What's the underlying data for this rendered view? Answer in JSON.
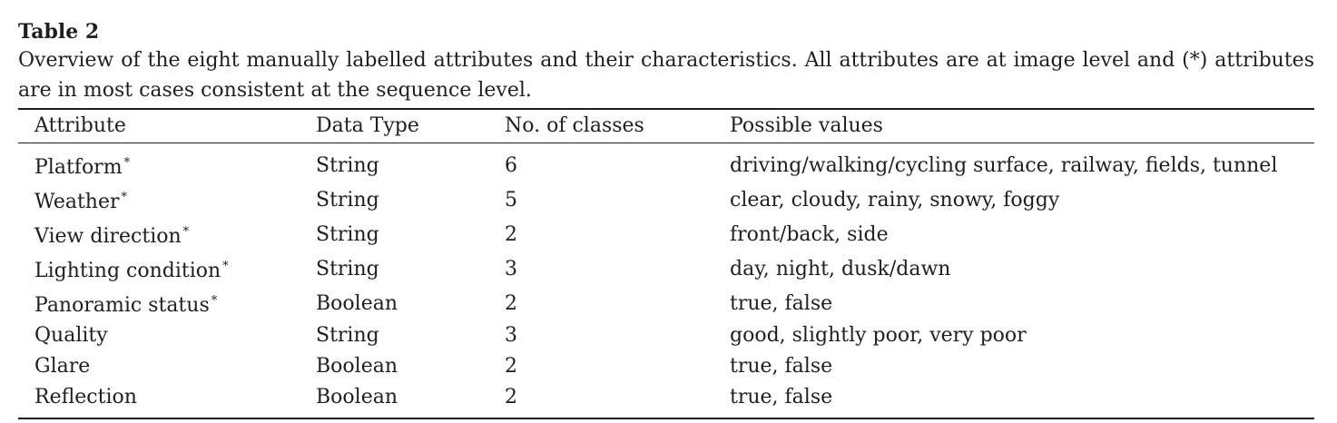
{
  "table": {
    "title": "Table 2",
    "caption": "Overview of the eight manually labelled attributes and their characteristics. All attributes are at image level and (*) attributes are in most cases consistent at the sequence level.",
    "headers": [
      "Attribute",
      "Data Type",
      "No. of classes",
      "Possible values"
    ],
    "star_mark": "*",
    "rows": [
      {
        "attribute": "Platform",
        "starred": true,
        "data_type": "String",
        "classes": "6",
        "values": "driving/walking/cycling surface, railway, fields, tunnel"
      },
      {
        "attribute": "Weather",
        "starred": true,
        "data_type": "String",
        "classes": "5",
        "values": "clear, cloudy, rainy, snowy, foggy"
      },
      {
        "attribute": "View direction",
        "starred": true,
        "data_type": "String",
        "classes": "2",
        "values": "front/back, side"
      },
      {
        "attribute": "Lighting condition",
        "starred": true,
        "data_type": "String",
        "classes": "3",
        "values": "day, night, dusk/dawn"
      },
      {
        "attribute": "Panoramic status",
        "starred": true,
        "data_type": "Boolean",
        "classes": "2",
        "values": "true, false"
      },
      {
        "attribute": "Quality",
        "starred": false,
        "data_type": "String",
        "classes": "3",
        "values": "good, slightly poor, very poor"
      },
      {
        "attribute": "Glare",
        "starred": false,
        "data_type": "Boolean",
        "classes": "2",
        "values": "true, false"
      },
      {
        "attribute": "Reflection",
        "starred": false,
        "data_type": "Boolean",
        "classes": "2",
        "values": "true, false"
      }
    ]
  }
}
